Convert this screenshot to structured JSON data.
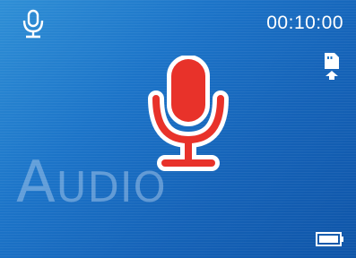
{
  "status": {
    "elapsed_time": "00:10:00",
    "mode_icon": "microphone-icon",
    "storage_icon": "sd-card-icon",
    "battery_icon": "battery-icon",
    "battery_level": 1.0
  },
  "main": {
    "center_icon": "microphone-icon",
    "watermark_first": "A",
    "watermark_rest": "UDIO"
  },
  "colors": {
    "background": "#1c74c8",
    "mic_red": "#e8322a",
    "icon_white": "#ffffff"
  }
}
